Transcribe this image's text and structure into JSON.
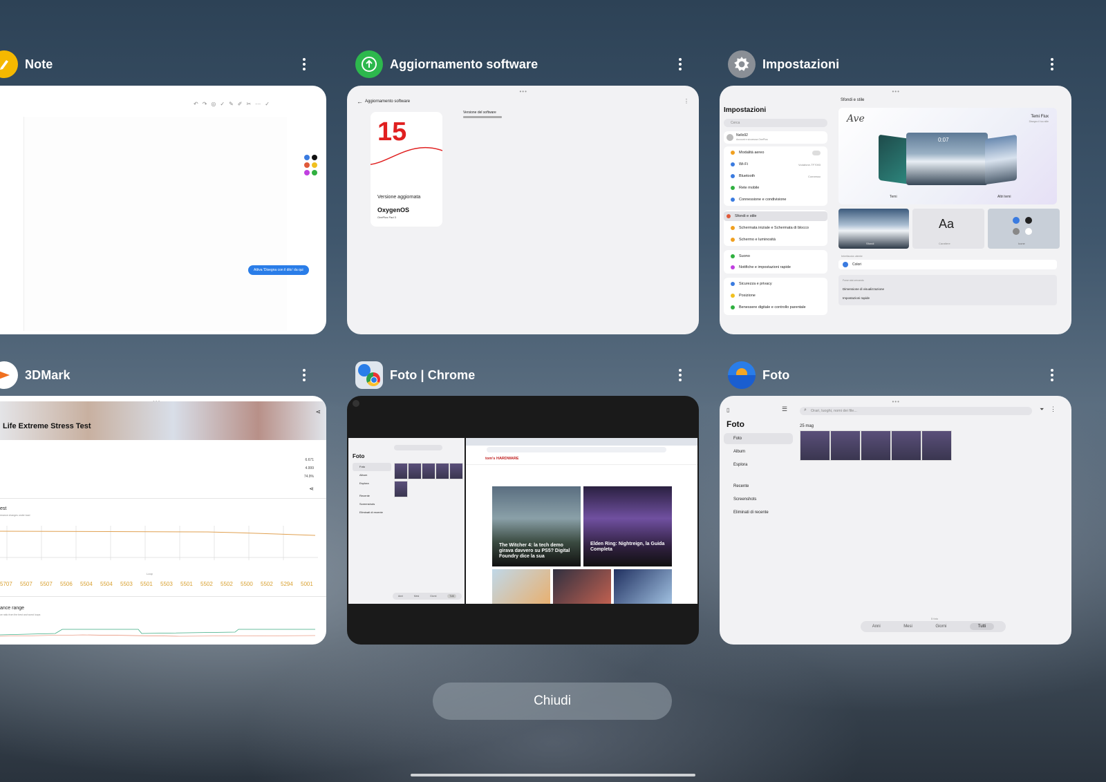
{
  "apps": {
    "note": {
      "title": "Note",
      "card": {
        "toast": "Attiva 'Disegna con il dito' da qui"
      }
    },
    "update": {
      "title": "Aggiornamento software",
      "card": {
        "header": "Aggiornamento software",
        "big_number": "15",
        "status": "Versione aggiornata",
        "os_name": "OxygenOS",
        "device": "OnePlus Pad 3",
        "version_label": "Versione del software"
      }
    },
    "settings": {
      "title": "Impostazioni",
      "card": {
        "heading": "Impostazioni",
        "search_placeholder": "Cerca",
        "account_name": "Nello92",
        "account_sub": "Account e sicurezza OnePlus",
        "groups": [
          [
            "Modalità aereo",
            "Wi-Fi",
            "Bluetooth",
            "Rete mobile",
            "Connessione e condivisione"
          ],
          [
            "Sfondi e stile",
            "Schermata iniziale e Schermata di blocco",
            "Schermo e luminosità"
          ],
          [
            "Suono",
            "Notifiche e impostazioni rapide"
          ],
          [
            "Sicurezza e privacy",
            "Posizione",
            "Benessere digitale e controllo parentale"
          ]
        ],
        "wifi_value": "Vodafone-TF7093",
        "bt_value": "Connesso",
        "right_title": "Sfondi e stile",
        "theme_name": "Temi Flux",
        "theme_sub": "Disegno il tuo stile",
        "clock": "0:07",
        "tab_temi": "Temi",
        "tab_altri": "Altri temi",
        "tile_sfondi": "Sfondi",
        "tile_aa": "Aa",
        "tile_carattere": "Carattere",
        "tile_icone": "Icone",
        "ui_label": "Interfaccia utente",
        "colori": "Colori",
        "more_label": "Forse stai cercando",
        "more_1": "Dimensione di visualizzazione",
        "more_2": "Impostazioni rapide"
      }
    },
    "mark3d": {
      "title": "3DMark",
      "card": {
        "banner": "Life Extreme Stress Test",
        "stat_values": [
          "6.671",
          "4.999",
          "74.9%"
        ],
        "section1": "est",
        "section1_sub": "rmance changes under load",
        "scores": [
          "5707",
          "5507",
          "5507",
          "5506",
          "5504",
          "5504",
          "5503",
          "5501",
          "5503",
          "5501",
          "5502",
          "5502",
          "5500",
          "5502",
          "5294",
          "5001"
        ],
        "section2": "ance range",
        "section2_sub": "ce ratio from the best and worst loops",
        "x_label": "Loop"
      }
    },
    "chrome": {
      "title": "Foto | Chrome",
      "card": {
        "foto_heading": "Foto",
        "foto_menu": [
          "Foto",
          "Album",
          "Esplora",
          "Recente",
          "Screenshots",
          "Eliminati di recente"
        ],
        "tabs_bar": [
          "Anni",
          "Mesi",
          "Giorni",
          "Tutti"
        ],
        "site": "tom's HARDWARE",
        "article1": "The Witcher 4: la tech demo girava davvero su PS5? Digital Foundry dice la sua",
        "article2": "Elden Ring: Nightreign, la Guida Completa"
      }
    },
    "foto": {
      "title": "Foto",
      "card": {
        "search_placeholder": "Orari, luoghi, nomi dei file...",
        "heading": "Foto",
        "menu": [
          "Foto",
          "Album",
          "Esplora"
        ],
        "menu2": [
          "Recente",
          "Screenshots",
          "Eliminati di recente"
        ],
        "date": "25 mag",
        "count": "5 foto",
        "tabs": [
          "Anni",
          "Mesi",
          "Giorni",
          "Tutti"
        ]
      }
    }
  },
  "close_label": "Chiudi"
}
